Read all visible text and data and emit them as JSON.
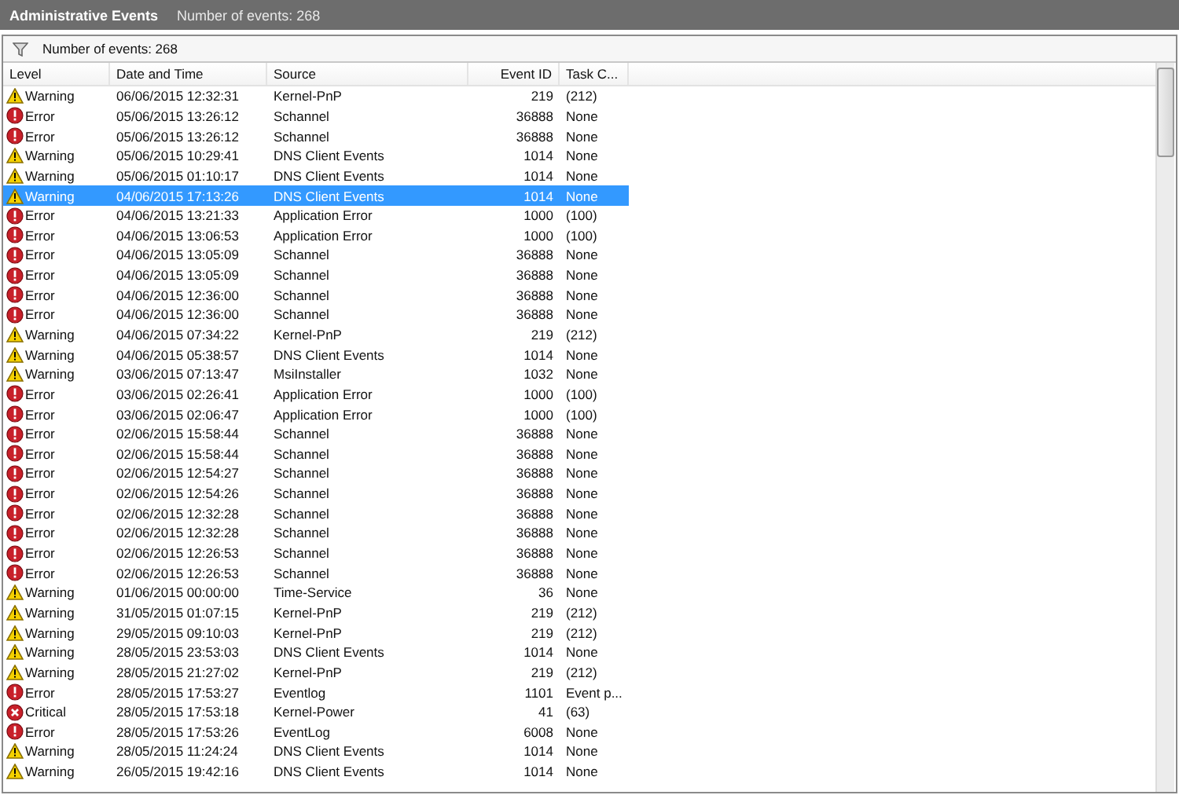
{
  "title_bar": {
    "title": "Administrative Events",
    "subtitle": "Number of events: 268"
  },
  "filter_bar": {
    "text": "Number of events: 268"
  },
  "table": {
    "columns": [
      "Level",
      "Date and Time",
      "Source",
      "Event ID",
      "Task C..."
    ],
    "rows": [
      {
        "kind": "warning",
        "level": "Warning",
        "date": "06/06/2015 12:32:31",
        "source": "Kernel-PnP",
        "event_id": "219",
        "task": "(212)",
        "selected": false
      },
      {
        "kind": "error",
        "level": "Error",
        "date": "05/06/2015 13:26:12",
        "source": "Schannel",
        "event_id": "36888",
        "task": "None",
        "selected": false
      },
      {
        "kind": "error",
        "level": "Error",
        "date": "05/06/2015 13:26:12",
        "source": "Schannel",
        "event_id": "36888",
        "task": "None",
        "selected": false
      },
      {
        "kind": "warning",
        "level": "Warning",
        "date": "05/06/2015 10:29:41",
        "source": "DNS Client Events",
        "event_id": "1014",
        "task": "None",
        "selected": false
      },
      {
        "kind": "warning",
        "level": "Warning",
        "date": "05/06/2015 01:10:17",
        "source": "DNS Client Events",
        "event_id": "1014",
        "task": "None",
        "selected": false
      },
      {
        "kind": "warning",
        "level": "Warning",
        "date": "04/06/2015 17:13:26",
        "source": "DNS Client Events",
        "event_id": "1014",
        "task": "None",
        "selected": true
      },
      {
        "kind": "error",
        "level": "Error",
        "date": "04/06/2015 13:21:33",
        "source": "Application Error",
        "event_id": "1000",
        "task": "(100)",
        "selected": false
      },
      {
        "kind": "error",
        "level": "Error",
        "date": "04/06/2015 13:06:53",
        "source": "Application Error",
        "event_id": "1000",
        "task": "(100)",
        "selected": false
      },
      {
        "kind": "error",
        "level": "Error",
        "date": "04/06/2015 13:05:09",
        "source": "Schannel",
        "event_id": "36888",
        "task": "None",
        "selected": false
      },
      {
        "kind": "error",
        "level": "Error",
        "date": "04/06/2015 13:05:09",
        "source": "Schannel",
        "event_id": "36888",
        "task": "None",
        "selected": false
      },
      {
        "kind": "error",
        "level": "Error",
        "date": "04/06/2015 12:36:00",
        "source": "Schannel",
        "event_id": "36888",
        "task": "None",
        "selected": false
      },
      {
        "kind": "error",
        "level": "Error",
        "date": "04/06/2015 12:36:00",
        "source": "Schannel",
        "event_id": "36888",
        "task": "None",
        "selected": false
      },
      {
        "kind": "warning",
        "level": "Warning",
        "date": "04/06/2015 07:34:22",
        "source": "Kernel-PnP",
        "event_id": "219",
        "task": "(212)",
        "selected": false
      },
      {
        "kind": "warning",
        "level": "Warning",
        "date": "04/06/2015 05:38:57",
        "source": "DNS Client Events",
        "event_id": "1014",
        "task": "None",
        "selected": false
      },
      {
        "kind": "warning",
        "level": "Warning",
        "date": "03/06/2015 07:13:47",
        "source": "MsiInstaller",
        "event_id": "1032",
        "task": "None",
        "selected": false
      },
      {
        "kind": "error",
        "level": "Error",
        "date": "03/06/2015 02:26:41",
        "source": "Application Error",
        "event_id": "1000",
        "task": "(100)",
        "selected": false
      },
      {
        "kind": "error",
        "level": "Error",
        "date": "03/06/2015 02:06:47",
        "source": "Application Error",
        "event_id": "1000",
        "task": "(100)",
        "selected": false
      },
      {
        "kind": "error",
        "level": "Error",
        "date": "02/06/2015 15:58:44",
        "source": "Schannel",
        "event_id": "36888",
        "task": "None",
        "selected": false
      },
      {
        "kind": "error",
        "level": "Error",
        "date": "02/06/2015 15:58:44",
        "source": "Schannel",
        "event_id": "36888",
        "task": "None",
        "selected": false
      },
      {
        "kind": "error",
        "level": "Error",
        "date": "02/06/2015 12:54:27",
        "source": "Schannel",
        "event_id": "36888",
        "task": "None",
        "selected": false
      },
      {
        "kind": "error",
        "level": "Error",
        "date": "02/06/2015 12:54:26",
        "source": "Schannel",
        "event_id": "36888",
        "task": "None",
        "selected": false
      },
      {
        "kind": "error",
        "level": "Error",
        "date": "02/06/2015 12:32:28",
        "source": "Schannel",
        "event_id": "36888",
        "task": "None",
        "selected": false
      },
      {
        "kind": "error",
        "level": "Error",
        "date": "02/06/2015 12:32:28",
        "source": "Schannel",
        "event_id": "36888",
        "task": "None",
        "selected": false
      },
      {
        "kind": "error",
        "level": "Error",
        "date": "02/06/2015 12:26:53",
        "source": "Schannel",
        "event_id": "36888",
        "task": "None",
        "selected": false
      },
      {
        "kind": "error",
        "level": "Error",
        "date": "02/06/2015 12:26:53",
        "source": "Schannel",
        "event_id": "36888",
        "task": "None",
        "selected": false
      },
      {
        "kind": "warning",
        "level": "Warning",
        "date": "01/06/2015 00:00:00",
        "source": "Time-Service",
        "event_id": "36",
        "task": "None",
        "selected": false
      },
      {
        "kind": "warning",
        "level": "Warning",
        "date": "31/05/2015 01:07:15",
        "source": "Kernel-PnP",
        "event_id": "219",
        "task": "(212)",
        "selected": false
      },
      {
        "kind": "warning",
        "level": "Warning",
        "date": "29/05/2015 09:10:03",
        "source": "Kernel-PnP",
        "event_id": "219",
        "task": "(212)",
        "selected": false
      },
      {
        "kind": "warning",
        "level": "Warning",
        "date": "28/05/2015 23:53:03",
        "source": "DNS Client Events",
        "event_id": "1014",
        "task": "None",
        "selected": false
      },
      {
        "kind": "warning",
        "level": "Warning",
        "date": "28/05/2015 21:27:02",
        "source": "Kernel-PnP",
        "event_id": "219",
        "task": "(212)",
        "selected": false
      },
      {
        "kind": "error",
        "level": "Error",
        "date": "28/05/2015 17:53:27",
        "source": "Eventlog",
        "event_id": "1101",
        "task": "Event p...",
        "selected": false
      },
      {
        "kind": "critical",
        "level": "Critical",
        "date": "28/05/2015 17:53:18",
        "source": "Kernel-Power",
        "event_id": "41",
        "task": "(63)",
        "selected": false
      },
      {
        "kind": "error",
        "level": "Error",
        "date": "28/05/2015 17:53:26",
        "source": "EventLog",
        "event_id": "6008",
        "task": "None",
        "selected": false
      },
      {
        "kind": "warning",
        "level": "Warning",
        "date": "28/05/2015 11:24:24",
        "source": "DNS Client Events",
        "event_id": "1014",
        "task": "None",
        "selected": false
      },
      {
        "kind": "warning",
        "level": "Warning",
        "date": "26/05/2015 19:42:16",
        "source": "DNS Client Events",
        "event_id": "1014",
        "task": "None",
        "selected": false
      }
    ]
  }
}
